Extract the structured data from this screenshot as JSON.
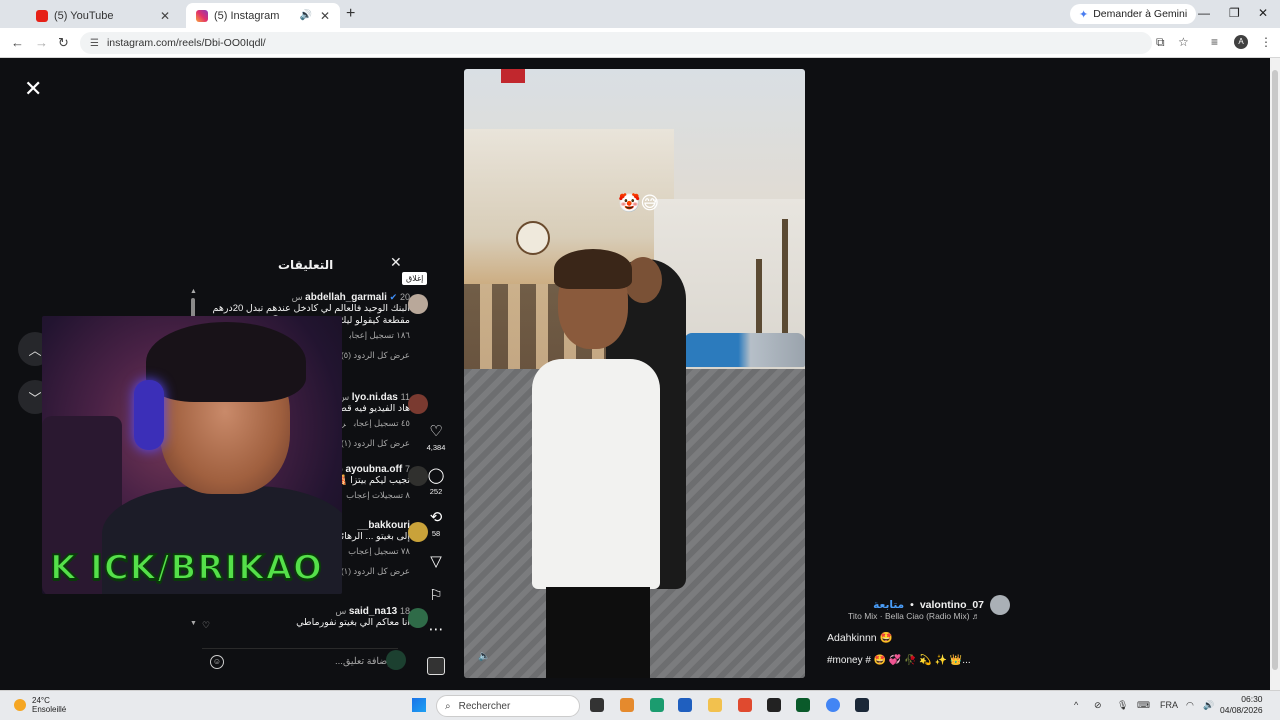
{
  "browser": {
    "tabs": [
      {
        "title": "(5) YouTube",
        "favicon": "youtube-icon",
        "active": false
      },
      {
        "title": "(5) Instagram",
        "favicon": "instagram-icon",
        "active": true
      }
    ],
    "gemini_label": "Demander à Gemini",
    "url": "instagram.com/reels/Dbi-OO0Iqdl/"
  },
  "comments": {
    "title": "التعليقات",
    "close_tooltip": "إغلاق",
    "input_placeholder": "إضافة تعليق...",
    "items": [
      {
        "username": "abdellah_garmali",
        "verified": true,
        "time": "20 س",
        "text": "البنك الوحيد فالعالم لي كادخل عندهم تبدل 20درهم مقطعة كيقولو ليك سيمانة و رجع 😂",
        "likes": "١٨٦ تسجيل إعجاب",
        "reply": "رد",
        "view_replies": "عرض كل الردود (٥)"
      },
      {
        "username": "lyo.ni.das",
        "verified": false,
        "time": "11 س",
        "text": "هاد الفيديو فيه قصة",
        "likes": "٤٥ تسجيل إعجاب",
        "reply": "رد",
        "view_replies": "عرض كل الردود (١)"
      },
      {
        "username": "ayoubna.off",
        "verified": false,
        "time": "7 س",
        "text": "تجيب ليكم بيتزا 🍕",
        "likes": "٨ تسجيلات إعجاب",
        "reply": "",
        "view_replies": ""
      },
      {
        "username": "bakkouri__",
        "verified": false,
        "time": "",
        "text": "إلى بغيتو ... الرهائن لدا",
        "likes": "٧٨ تسجيل إعجاب",
        "reply": "",
        "view_replies": "عرض كل الردود (١)"
      },
      {
        "username": "said_na13",
        "verified": false,
        "time": "18 س",
        "text": "انا معاكم الي بغيتو نفورماطي",
        "likes": "",
        "reply": "",
        "view_replies": ""
      }
    ]
  },
  "actions": {
    "like_count": "4,384",
    "comment_count": "252",
    "repost_count": "58"
  },
  "reel": {
    "author": "valontino_07",
    "follow_label": "متابعة",
    "separator": "•",
    "music": "Tito Mix · Bella Ciao (Radio Mix) ♬",
    "caption": "Adahkinnn 🤩",
    "tags": "#money # 🤩 💞 🥀 💫 ✨ 👑..."
  },
  "overlay": {
    "stream_logo": "K ICK/BRIKAO"
  },
  "taskbar": {
    "temperature": "24°C",
    "weather": "Ensoleillé",
    "search_label": "Rechercher",
    "language": "FRA",
    "time": "06:30",
    "date": "04/08/2026"
  },
  "colors": {
    "accent_blue": "#4a9df8",
    "verified_blue": "#3f8ef8",
    "page_bg": "#0e0f12"
  }
}
